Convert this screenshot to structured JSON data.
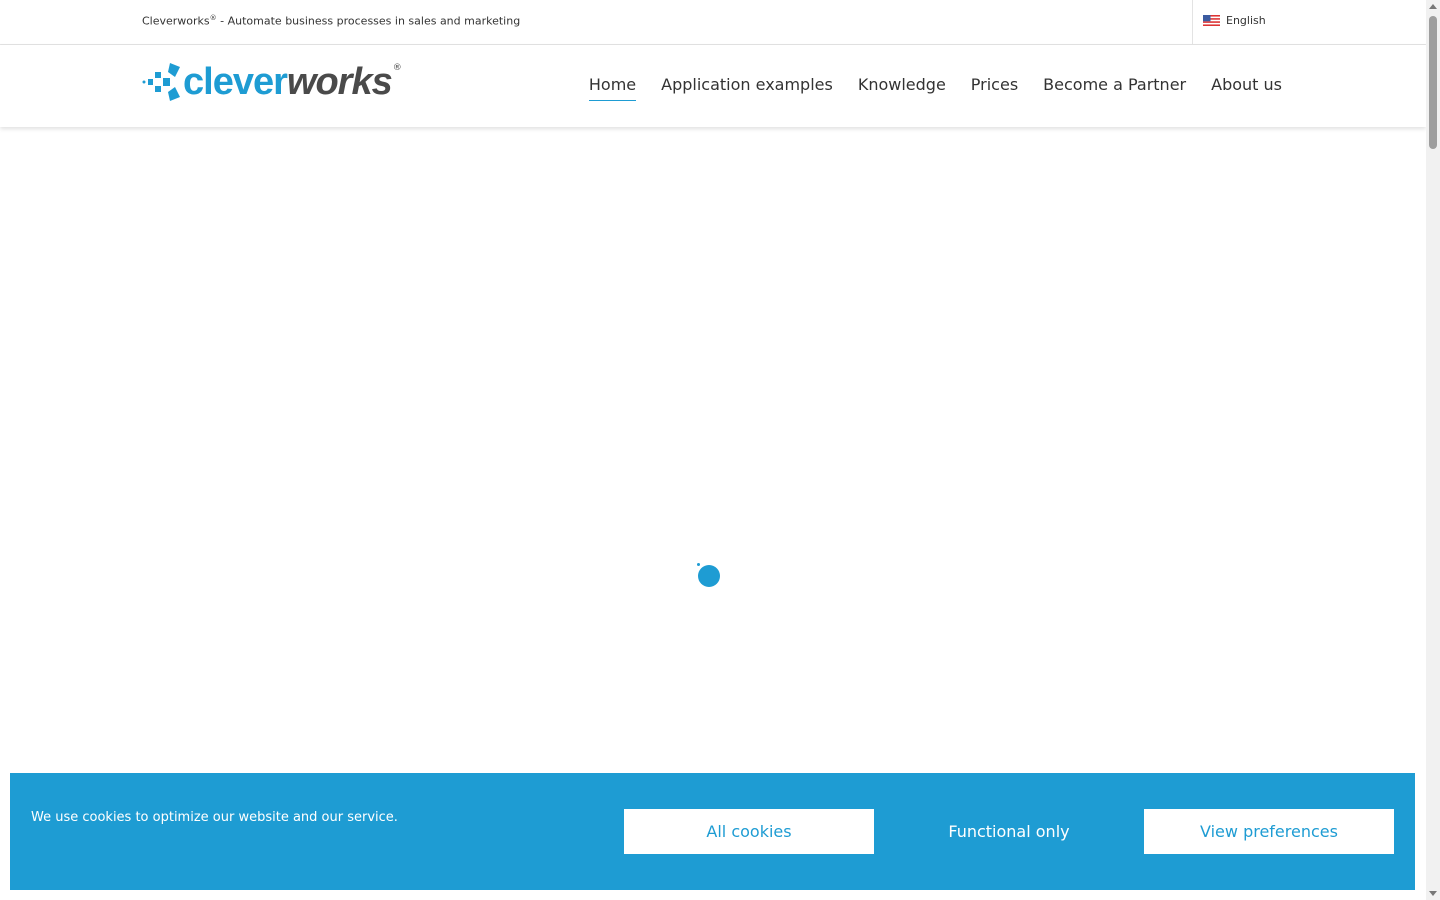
{
  "topbar": {
    "tagline_brand": "Cleverworks",
    "tagline_reg": "®",
    "tagline_rest": " - Automate business processes in sales and marketing",
    "language": "English"
  },
  "logo": {
    "part1": "clever",
    "part2": "works",
    "reg": "®"
  },
  "nav": {
    "items": [
      {
        "label": "Home",
        "active": true
      },
      {
        "label": "Application examples"
      },
      {
        "label": "Knowledge"
      },
      {
        "label": "Prices"
      },
      {
        "label": "Become a Partner"
      },
      {
        "label": "About us"
      }
    ]
  },
  "cookie_banner": {
    "text": "We use cookies to optimize our website and our service.",
    "all_cookies": "All cookies",
    "functional_only": "Functional only",
    "view_preferences": "View preferences"
  },
  "colors": {
    "brand_blue": "#1e9cd3",
    "brand_grey": "#4a4a4a"
  },
  "icons": {
    "flag": "us-flag-icon",
    "loader": "loading-spinner-icon"
  }
}
